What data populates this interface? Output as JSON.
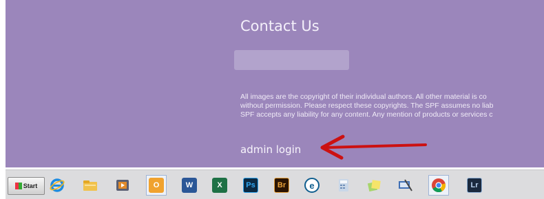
{
  "footer": {
    "title": "Contact Us",
    "disclaimer_lines": [
      "All images are the copyright of their individual authors. All other material is co",
      "without permission. Please respect these copyrights. The SPF assumes no liab",
      "SPF accepts any liability for any content. Any mention of products or services c"
    ],
    "admin_link": "admin login"
  },
  "annotation": {
    "arrow_color": "#cc1111"
  },
  "colors": {
    "page_bg": "#9b86bb",
    "taskbar_bg": "#dcdcde"
  },
  "taskbar": {
    "start_label": "Start",
    "apps": [
      {
        "icon": "internet-explorer-icon",
        "label": ""
      },
      {
        "icon": "file-explorer-icon",
        "label": ""
      },
      {
        "icon": "media-player-icon",
        "label": ""
      },
      {
        "icon": "outlook-icon",
        "label": "O"
      },
      {
        "icon": "word-icon",
        "label": "W"
      },
      {
        "icon": "excel-icon",
        "label": "X"
      },
      {
        "icon": "photoshop-icon",
        "label": "Ps"
      },
      {
        "icon": "bridge-icon",
        "label": "Br"
      },
      {
        "icon": "edge-icon",
        "label": "e"
      },
      {
        "icon": "calculator-icon",
        "label": ""
      },
      {
        "icon": "sticky-notes-icon",
        "label": ""
      },
      {
        "icon": "snipping-tool-icon",
        "label": ""
      },
      {
        "icon": "chrome-icon",
        "label": ""
      },
      {
        "icon": "lightroom-icon",
        "label": "Lr"
      }
    ]
  }
}
